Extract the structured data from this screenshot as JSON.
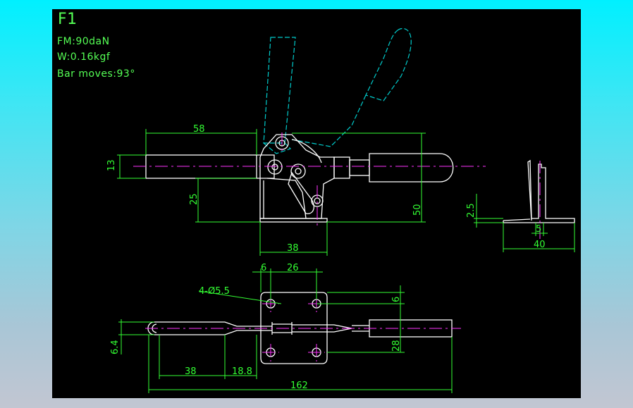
{
  "drawing": {
    "title": "F1",
    "specs": [
      "FM:90daN",
      "W:0.16kgf",
      "Bar moves:93°"
    ]
  },
  "dimensions": {
    "side_view": {
      "d58": "58",
      "d13": "13",
      "d25": "25",
      "d50": "50",
      "d38": "38"
    },
    "end_view": {
      "d2_5": "2.5",
      "d5": "5",
      "d40": "40"
    },
    "top_view": {
      "d6a": "6",
      "d26": "26",
      "holes": "4-Ø5.5",
      "d6b": "6",
      "d6_4": "6.4",
      "d28": "28",
      "d38": "38",
      "d18_8": "18.8",
      "d162": "162"
    }
  },
  "colors": {
    "background": "#000000",
    "outline": "#ffffff",
    "dimension": "#33ff33",
    "centerline": "#ff33ff",
    "phantom": "#00cccc"
  }
}
